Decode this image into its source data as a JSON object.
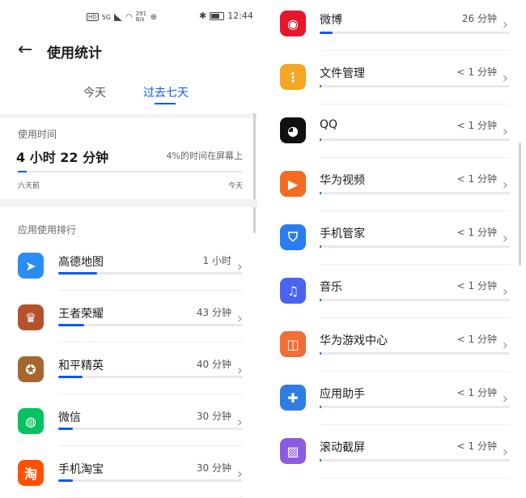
{
  "status_bar": {
    "signal_text": "5G",
    "net_speed": "291 B/s",
    "time": "12:44"
  },
  "header": {
    "back_icon": "arrow-left-icon",
    "title": "使用统计"
  },
  "tabs": [
    {
      "label": "今天",
      "selected": false
    },
    {
      "label": "过去七天",
      "selected": true
    }
  ],
  "usage": {
    "label": "使用时间",
    "total": "4 小时 22 分钟",
    "percent_text": "4%的时间在屏幕上",
    "percent_value": 0.04,
    "axis_start": "六天前",
    "axis_end": "今天"
  },
  "ranking": {
    "label": "应用使用排行",
    "items": [
      {
        "name": "高德地图",
        "time": "1 小时",
        "usage_fraction": 0.21,
        "icon": "amap-icon",
        "color": "#2a8cf5"
      },
      {
        "name": "王者荣耀",
        "time": "43 分钟",
        "usage_fraction": 0.14,
        "icon": "honor-of-kings-icon",
        "color": "#b5522b"
      },
      {
        "name": "和平精英",
        "time": "40 分钟",
        "usage_fraction": 0.13,
        "icon": "peacekeeper-elite-icon",
        "color": "#a5672f"
      },
      {
        "name": "微信",
        "time": "30 分钟",
        "usage_fraction": 0.08,
        "icon": "wechat-icon",
        "color": "#07c160"
      },
      {
        "name": "手机淘宝",
        "time": "30 分钟",
        "usage_fraction": 0.08,
        "icon": "taobao-icon",
        "color": "#ff5000"
      }
    ],
    "more_items": [
      {
        "name": "微博",
        "time": "26 分钟",
        "usage_fraction": 0.07,
        "icon": "weibo-icon",
        "color": "#e6162d"
      },
      {
        "name": "文件管理",
        "time": "< 1 分钟",
        "usage_fraction": 0.0,
        "icon": "file-manager-icon",
        "color": "#f5a623"
      },
      {
        "name": "QQ",
        "time": "< 1 分钟",
        "usage_fraction": 0.0,
        "icon": "qq-icon",
        "color": "#111111"
      },
      {
        "name": "华为视频",
        "time": "< 1 分钟",
        "usage_fraction": 0.0,
        "icon": "huawei-video-icon",
        "color": "#f46b21"
      },
      {
        "name": "手机管家",
        "time": "< 1 分钟",
        "usage_fraction": 0.0,
        "icon": "phone-manager-icon",
        "color": "#2b7cf0"
      },
      {
        "name": "音乐",
        "time": "< 1 分钟",
        "usage_fraction": 0.0,
        "icon": "music-icon",
        "color": "#4a63f0"
      },
      {
        "name": "华为游戏中心",
        "time": "< 1 分钟",
        "usage_fraction": 0.0,
        "icon": "game-center-icon",
        "color": "#f36d36"
      },
      {
        "name": "应用助手",
        "time": "< 1 分钟",
        "usage_fraction": 0.0,
        "icon": "app-assistant-icon",
        "color": "#2f7de0"
      },
      {
        "name": "滚动截屏",
        "time": "< 1 分钟",
        "usage_fraction": 0.0,
        "icon": "scroll-screenshot-icon",
        "color": "#8c5be0"
      }
    ]
  },
  "accent_color": "#0a59f7"
}
